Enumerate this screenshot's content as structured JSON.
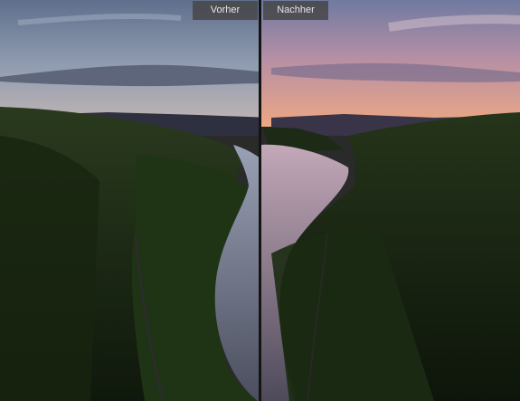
{
  "compare": {
    "before_label": "Vorher",
    "after_label": "Nachher"
  },
  "colors": {
    "before_sky_top": "#6e7f9a",
    "before_sky_bottom": "#b9b1b4",
    "after_sky_top": "#7b84a6",
    "after_sky_bottom": "#e6a68e",
    "forest": "#1d2e16",
    "water": "#8f8ba3"
  }
}
